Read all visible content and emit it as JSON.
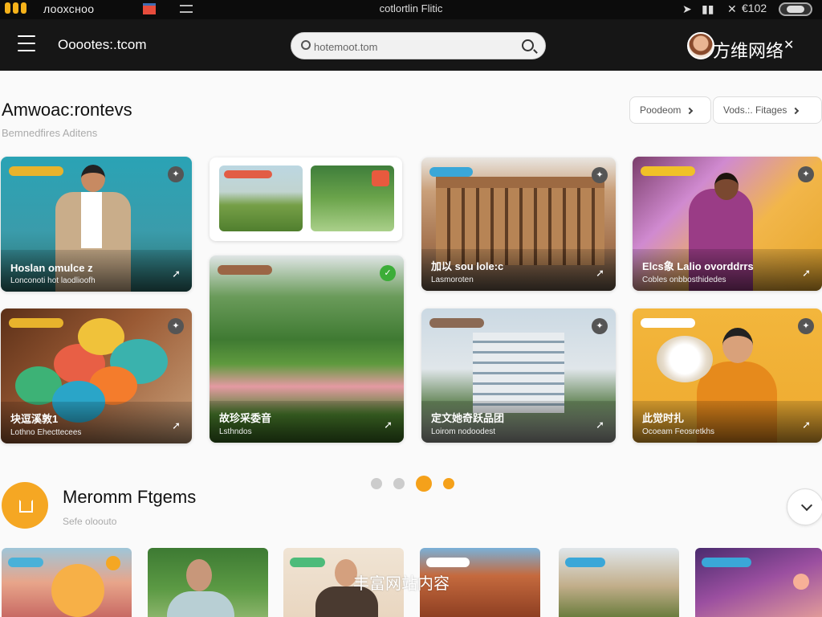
{
  "status_bar": {
    "left_text": "лоохсноо",
    "center_title": "сotlortlin Flitic",
    "battery_text": "€102"
  },
  "header": {
    "app_title": "Ooootes:.tcom",
    "search_placeholder": "hotemoot.tom",
    "watermark": "方维网络"
  },
  "section1": {
    "title": "Amwoac:rontevs",
    "subtitle": "Bemnedfires Aditens",
    "filters": [
      {
        "label": "Poodeom"
      },
      {
        "label": "Vods.:. Fitages"
      }
    ]
  },
  "cards": [
    {
      "title": "Hoslan omulce z",
      "subtitle": "Lonconoti hot laodlioofh",
      "tag_color": "#e8b32c"
    },
    {
      "title": "加以 sou lole:c",
      "subtitle": "Lasmoroten",
      "tag_color": "#3aa7d8"
    },
    {
      "title": "Elcs象 Lalio ovorddrrs",
      "subtitle": "Cobles onbbosthidedes",
      "tag_color": "#f0c128"
    },
    {
      "title": "块逗溪敦1",
      "subtitle": "Lothno Ehecttecees",
      "tag_color": "#e8b32c"
    },
    {
      "title": "故珍采委音",
      "subtitle": "Lsthndos",
      "tag_color": "#9b6645"
    },
    {
      "title": "定文她奇跃品团",
      "subtitle": "Loirom nodoodest",
      "tag_color": "#8b6a55"
    },
    {
      "title": "此觉时扎",
      "subtitle": "Ocoeam Feosretkhs",
      "tag_color": "#ffffff"
    }
  ],
  "section2": {
    "title": "Meromm Ftgems",
    "subtitle": "Sefe oloouto"
  },
  "pager": {
    "count": 4,
    "active_index": 2
  },
  "bottom_watermark": "丰富网站内容",
  "colors": {
    "accent": "#f5a723",
    "header_bg": "#161616"
  }
}
